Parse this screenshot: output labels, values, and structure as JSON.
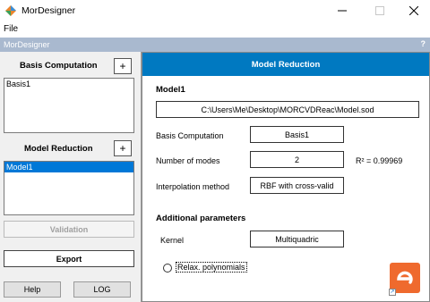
{
  "window": {
    "title": "MorDesigner"
  },
  "menu": {
    "file": "File"
  },
  "subbar": {
    "title": "MorDesigner",
    "help": "?"
  },
  "left": {
    "basis_title": "Basis Computation",
    "basis_plus": "+",
    "basis_items": [
      "Basis1"
    ],
    "model_title": "Model Reduction",
    "model_plus": "+",
    "model_items": [
      "Model1"
    ],
    "validation": "Validation",
    "export": "Export",
    "help": "Help",
    "log": "LOG"
  },
  "right": {
    "header": "Model Reduction",
    "model_name": "Model1",
    "file_path": "C:\\Users\\Me\\Desktop\\MORCVDReac\\Model.sod",
    "basis_label": "Basis Computation",
    "basis_value": "Basis1",
    "modes_label": "Number of modes",
    "modes_value": "2",
    "r2": "R² = 0.99969",
    "interp_label": "Interpolation method",
    "interp_value": "RBF with cross-valid",
    "additional_title": "Additional parameters",
    "kernel_label": "Kernel",
    "kernel_value": "Multiquadric",
    "relax_label": "Relax. polynomials"
  },
  "colors": {
    "accent": "#0079c1",
    "selection": "#0078d7",
    "subbar": "#a9b9cf",
    "logo": "#ef6a2e"
  }
}
